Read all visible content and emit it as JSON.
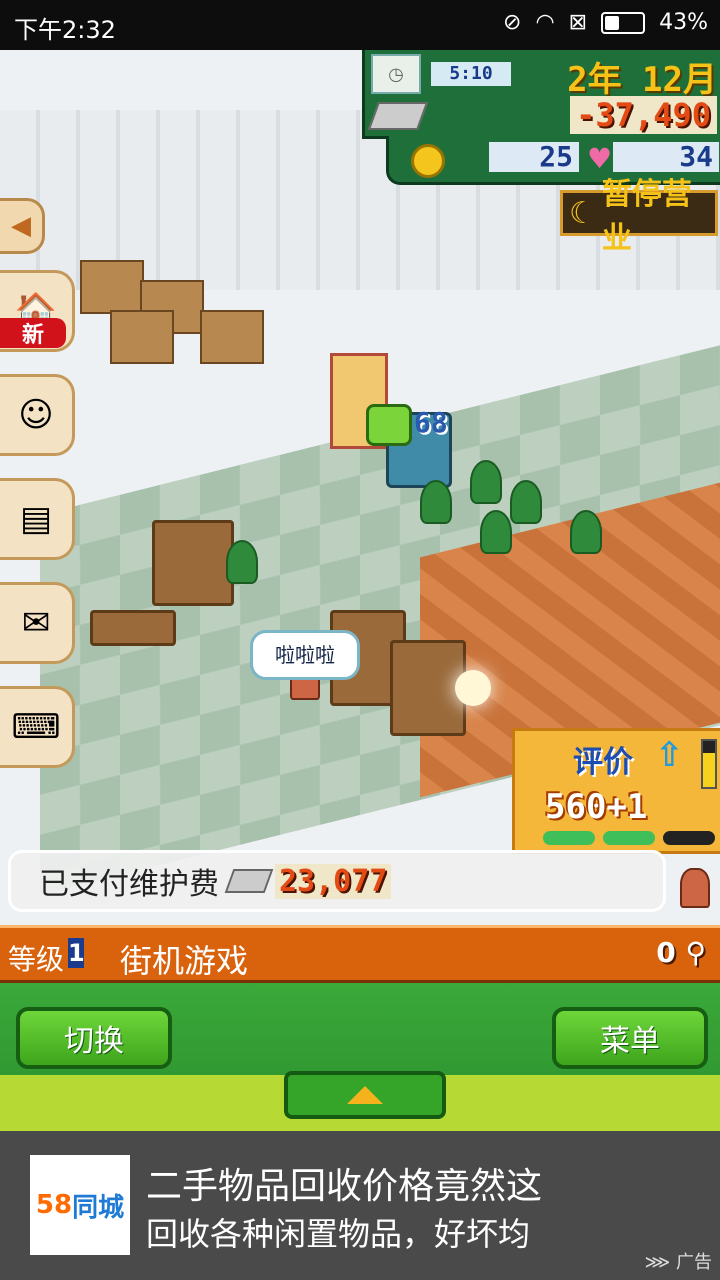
{
  "status_bar": {
    "time": "下午2:32",
    "battery": "43%",
    "battery_level": 0.43
  },
  "hud": {
    "clock": "5:10",
    "date": "2年 12月",
    "money": "-37,490",
    "coins": "25",
    "hearts": "34",
    "pause_label": "暂停营业"
  },
  "side_menu": {
    "new_badge": "新"
  },
  "scene": {
    "speech_bubble": "啦啦啦",
    "basket_count": "68"
  },
  "rating": {
    "label": "评价",
    "up_label": "上升",
    "score": "560+1",
    "level_fraction": 0.75
  },
  "notification": {
    "text": "已支付维护费",
    "amount": "23,077"
  },
  "level_bar": {
    "level_label": "等级",
    "level_value": "1",
    "store_name": "街机游戏",
    "visitor_count": "0"
  },
  "controls": {
    "switch_label": "切换",
    "menu_label": "菜单"
  },
  "ad": {
    "brand_num": "58",
    "brand_name": "同城",
    "line1": "二手物品回收价格竟然这",
    "line2": "回收各种闲置物品，好坏均",
    "tag": "广告"
  },
  "colors": {
    "hud_green": "#1f6f3a",
    "money_red": "#e34a14",
    "level_orange": "#d9620c",
    "button_green": "#3ea51c",
    "ad_gray": "#4a4a4a"
  }
}
